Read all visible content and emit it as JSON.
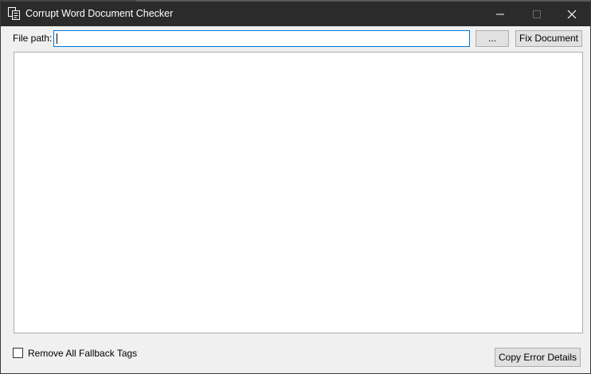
{
  "window": {
    "title": "Corrupt Word Document Checker",
    "icon": "app-document-icon",
    "controls": {
      "minimize_icon": "minimize-icon",
      "maximize_icon": "maximize-icon",
      "close_icon": "close-icon"
    }
  },
  "form": {
    "file_path_label": "File path:",
    "file_path_value": "",
    "browse_label": "...",
    "fix_document_label": "Fix Document",
    "output_text": "",
    "remove_fallback_label": "Remove All Fallback Tags",
    "remove_fallback_checked": false,
    "copy_error_label": "Copy Error Details"
  },
  "colors": {
    "titlebar_bg": "#2b2b2b",
    "titlebar_text": "#ffffff",
    "window_bg": "#f0f0f0",
    "input_focus_border": "#0078d7",
    "button_bg": "#e1e1e1",
    "button_border": "#adadad"
  }
}
